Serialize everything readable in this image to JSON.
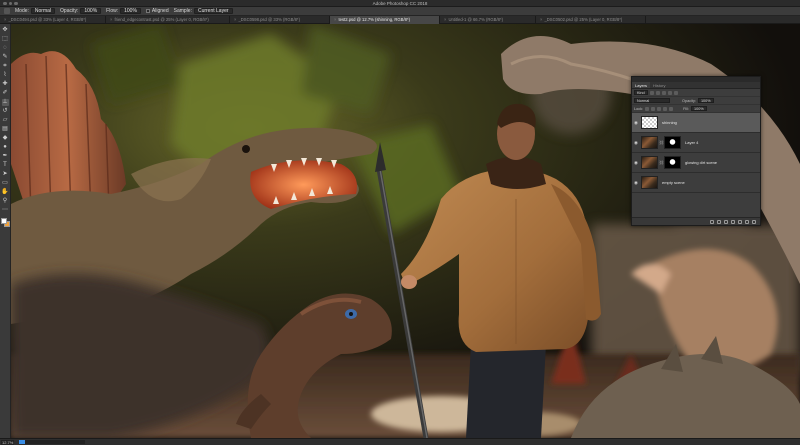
{
  "window": {
    "title": "Adobe Photoshop CC 2018"
  },
  "options_bar": {
    "mode_label": "Mode:",
    "mode_value": "Normal",
    "opacity_label": "Opacity:",
    "opacity_value": "100%",
    "flow_label": "Flow:",
    "flow_value": "100%",
    "aligned_label": "Aligned",
    "sample_label": "Sample:",
    "sample_value": "Current Layer"
  },
  "tabs": [
    {
      "label": "_DSC0494.psd @ 33% (Layer 4, RGB/8*)"
    },
    {
      "label": "friend_edgecontrast.psd @ 25% (Layer 0, RGB/8*)"
    },
    {
      "label": "_DSC0598.psd @ 33% (RGB/8*)"
    },
    {
      "label": "test2.psd @ 12.7% (shinning, RGB/8*)"
    },
    {
      "label": "Untitled-1 @ 66.7% (RGB/8*)"
    },
    {
      "label": "_DSC0502.psd @ 25% (Layer 0, RGB/8*)"
    }
  ],
  "active_tab": 3,
  "toolbar": {
    "tools": [
      {
        "name": "move-tool-icon",
        "glyph": "✥"
      },
      {
        "name": "marquee-tool-icon",
        "glyph": "⬚"
      },
      {
        "name": "lasso-tool-icon",
        "glyph": "◌"
      },
      {
        "name": "quick-select-tool-icon",
        "glyph": "✎"
      },
      {
        "name": "crop-tool-icon",
        "glyph": "⌗"
      },
      {
        "name": "eyedropper-tool-icon",
        "glyph": "⌇"
      },
      {
        "name": "healing-brush-tool-icon",
        "glyph": "✚"
      },
      {
        "name": "brush-tool-icon",
        "glyph": "✐"
      },
      {
        "name": "clone-stamp-tool-icon",
        "glyph": "⊥"
      },
      {
        "name": "history-brush-tool-icon",
        "glyph": "↺"
      },
      {
        "name": "eraser-tool-icon",
        "glyph": "▱"
      },
      {
        "name": "gradient-tool-icon",
        "glyph": "▤"
      },
      {
        "name": "blur-tool-icon",
        "glyph": "◆"
      },
      {
        "name": "dodge-tool-icon",
        "glyph": "●"
      },
      {
        "name": "pen-tool-icon",
        "glyph": "✒"
      },
      {
        "name": "type-tool-icon",
        "glyph": "T"
      },
      {
        "name": "path-select-tool-icon",
        "glyph": "➤"
      },
      {
        "name": "shape-tool-icon",
        "glyph": "▭"
      },
      {
        "name": "hand-tool-icon",
        "glyph": "✋"
      },
      {
        "name": "zoom-tool-icon",
        "glyph": "⚲"
      },
      {
        "name": "more-tools-icon",
        "glyph": "⋯"
      }
    ],
    "selected_index": 8,
    "foreground_color": "#ffffff",
    "background_color": "#f1a23b"
  },
  "layers_panel": {
    "tabs": [
      "Layers",
      "History"
    ],
    "active_tab": 0,
    "filter_value": "Kind",
    "blend_mode": "Normal",
    "opacity_label": "Opacity:",
    "opacity_value": "100%",
    "lock_label": "Lock:",
    "fill_label": "Fill:",
    "fill_value": "100%",
    "layers": [
      {
        "name": "shinning",
        "thumb": "transparent",
        "has_mask": false,
        "active": true
      },
      {
        "name": "Layer 4",
        "thumb": "photo",
        "has_mask": true,
        "active": false
      },
      {
        "name": "glowing dirt scene",
        "thumb": "photo",
        "has_mask": true,
        "active": false
      },
      {
        "name": "empty scene",
        "thumb": "photo",
        "has_mask": false,
        "active": false
      }
    ]
  },
  "status_bar": {
    "zoom_value": "12.7%",
    "progress_fraction": 0.09
  },
  "colors": {
    "accent_blue": "#3a8ee6",
    "jacket": "#a7733f",
    "mouth_glow": "#e8673a"
  }
}
